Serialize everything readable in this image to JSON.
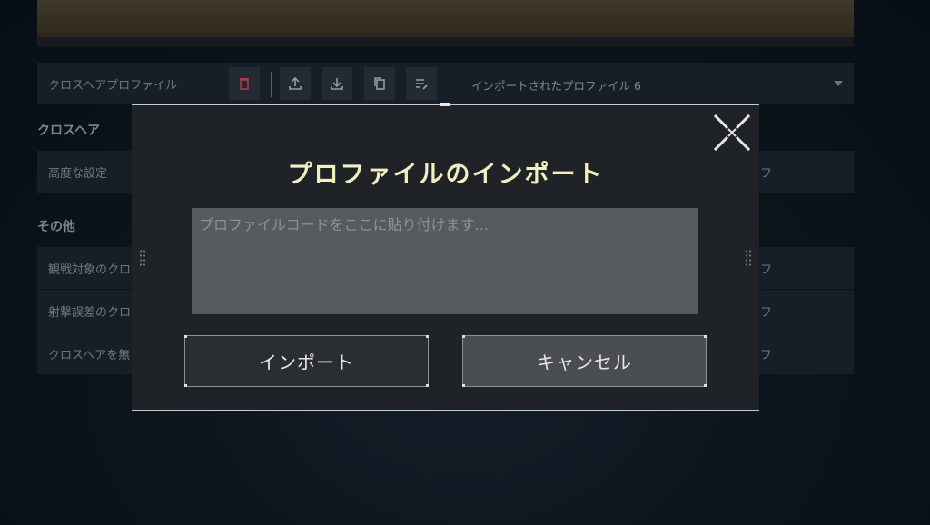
{
  "background_panel": {
    "profile_label": "クロスヘアプロファイル",
    "selected_profile": "インポートされたプロファイル 6",
    "toolbar_icons": [
      "delete-icon",
      "upload-icon",
      "download-icon",
      "copy-icon",
      "edit-list-icon"
    ],
    "sections": {
      "crosshair_header": "クロスヘア",
      "advanced_settings": "高度な設定",
      "other_header": "その他",
      "rows": [
        {
          "label": "観戦対象のクロ",
          "value": "フ"
        },
        {
          "label": "射撃誤差のクロ",
          "value": "フ"
        },
        {
          "label": "クロスヘアを無",
          "value": "フ"
        }
      ],
      "advanced_value": "フ"
    }
  },
  "modal": {
    "title": "プロファイルのインポート",
    "input_placeholder": "プロファイルコードをここに貼り付けます...",
    "input_value": "",
    "import_label": "インポート",
    "cancel_label": "キャンセル",
    "close_icon": "close-x-icon"
  },
  "colors": {
    "title": "#f2eec0",
    "modal_bg": "#1f2328",
    "input_bg": "#575a5e",
    "cancel_bg": "#4a4d51",
    "delete_icon": "#c84b55"
  }
}
